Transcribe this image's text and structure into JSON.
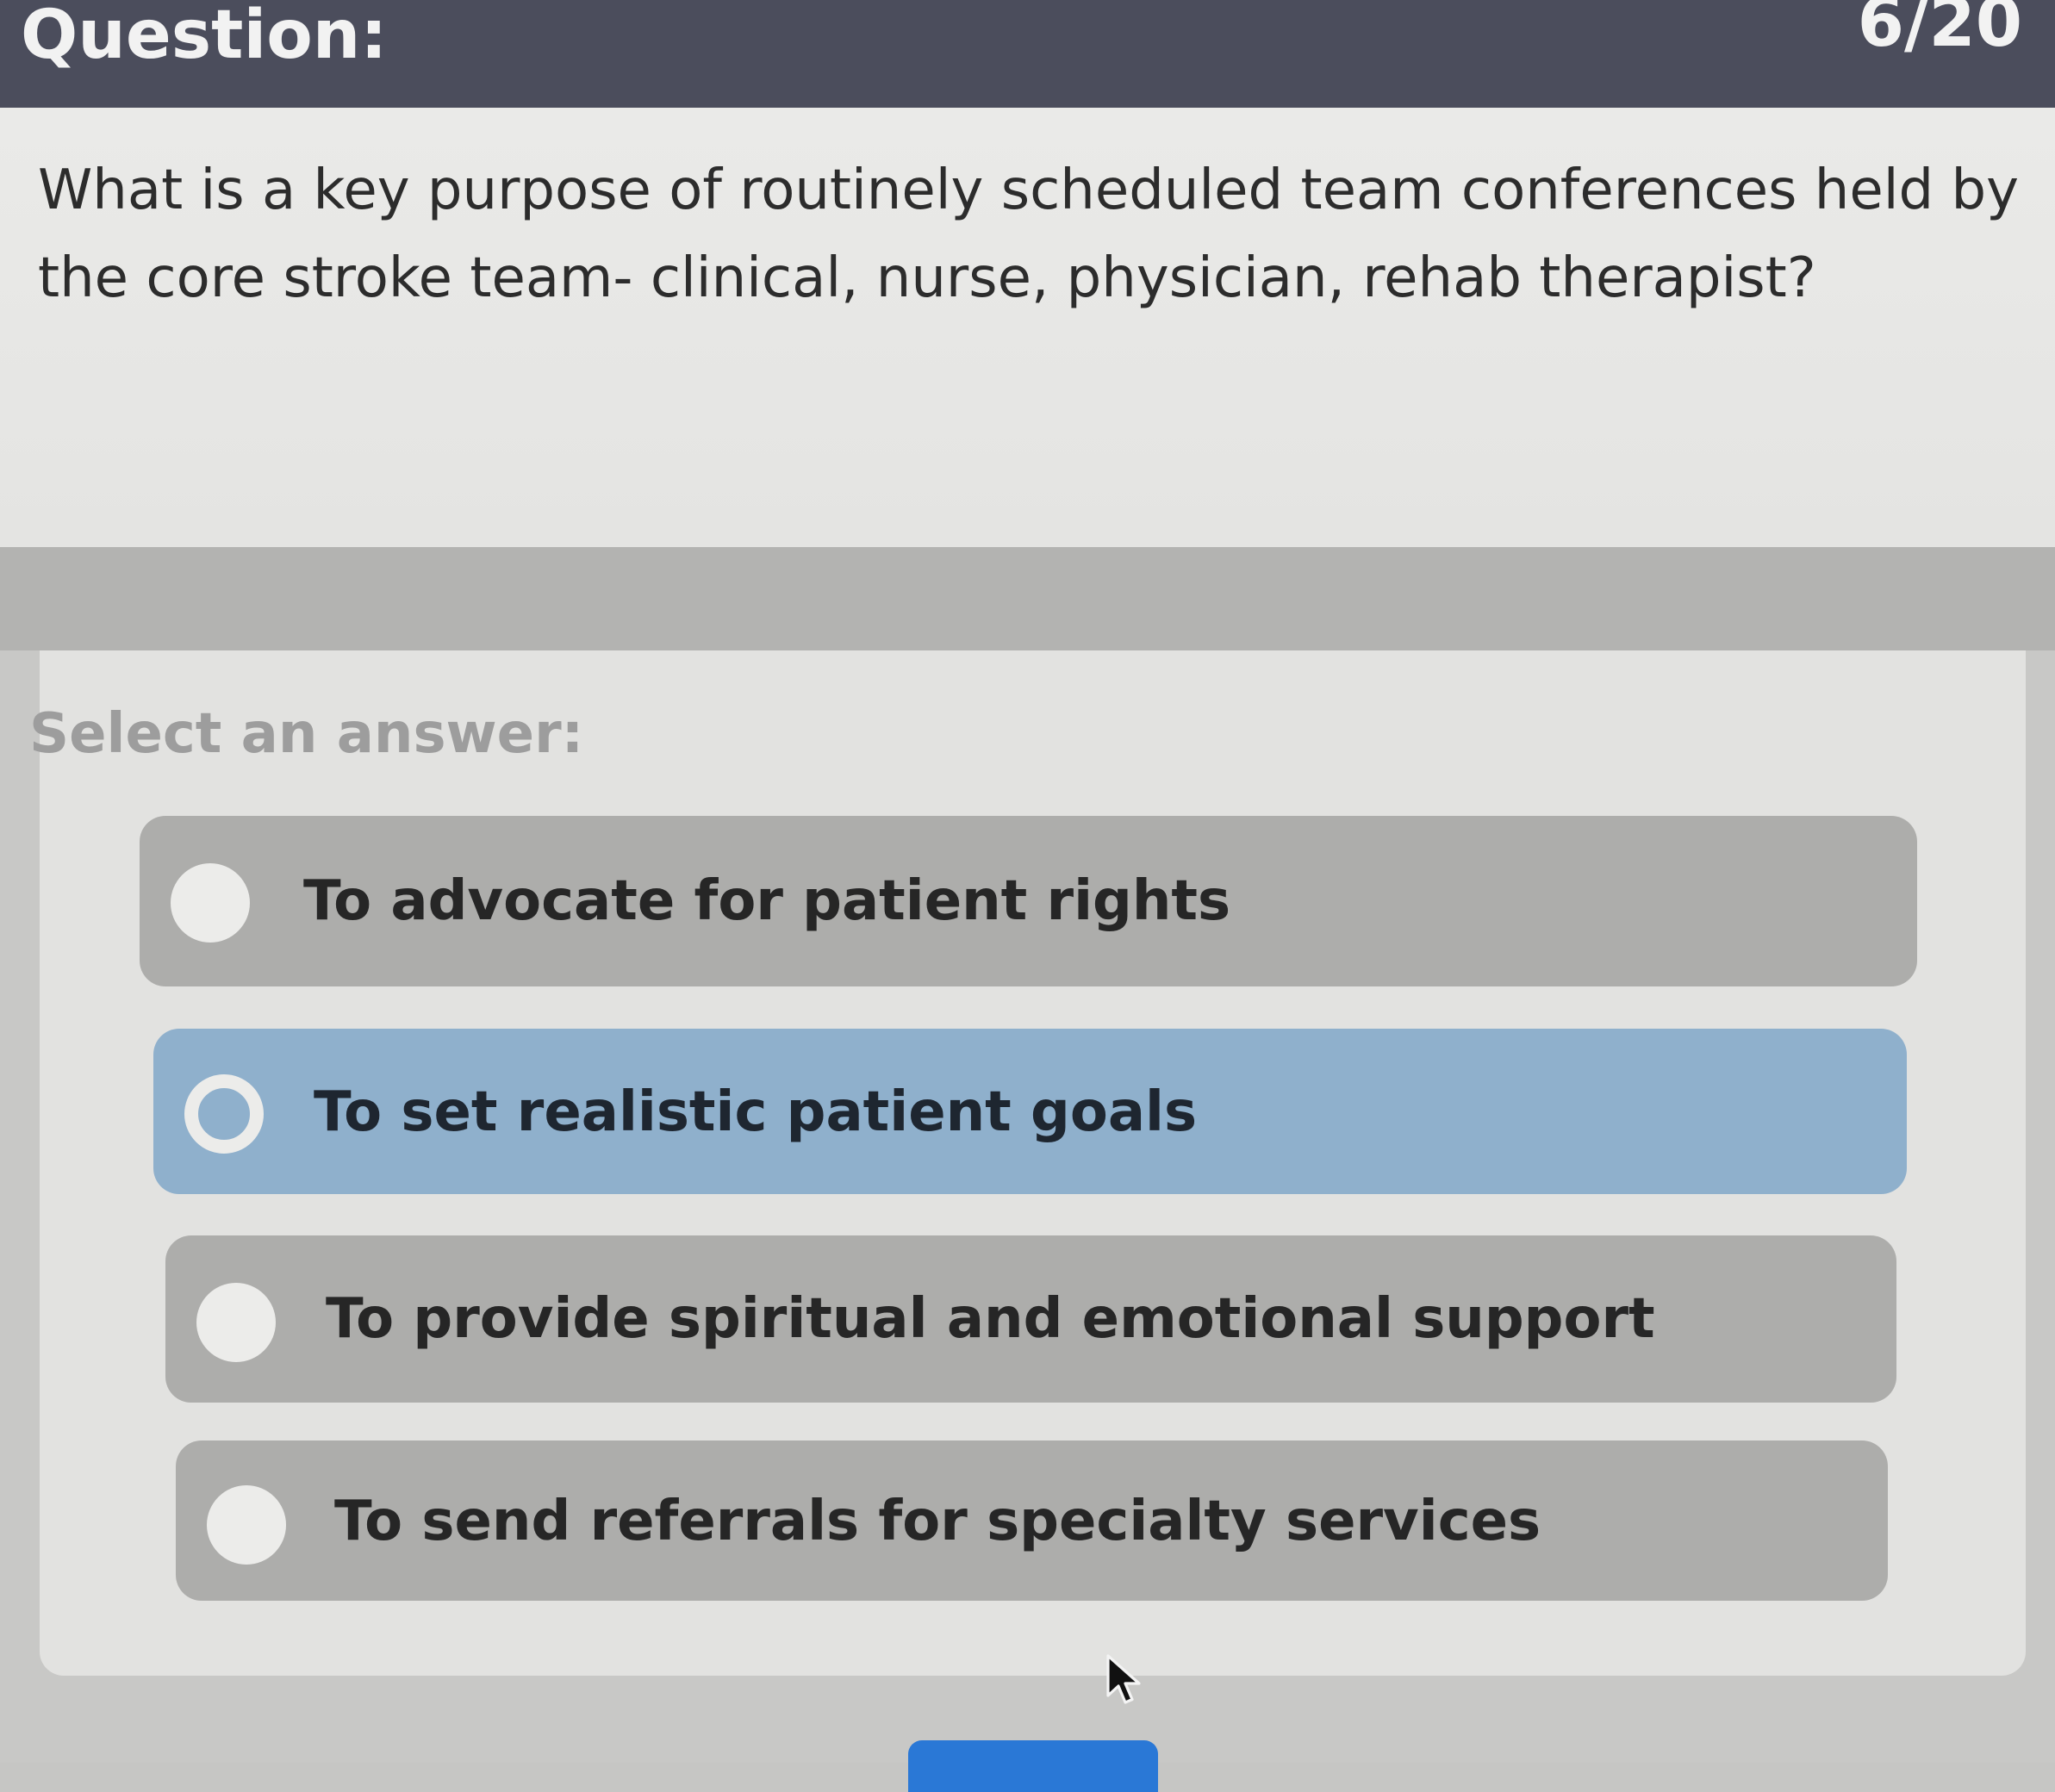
{
  "header": {
    "title": "Question:",
    "counter": "6/20"
  },
  "question": {
    "text": "What is a key purpose of routinely scheduled team conferences held by the core stroke team- clinical, nurse, physician, rehab therapist?"
  },
  "answers": {
    "prompt": "Select an answer:",
    "selected_index": 1,
    "options": [
      {
        "label": "To advocate for patient rights"
      },
      {
        "label": "To set realistic patient goals"
      },
      {
        "label": "To provide spiritual and emotional support"
      },
      {
        "label": "To send referrals for specialty services"
      }
    ]
  },
  "colors": {
    "header_bg": "#4b4d5c",
    "selected_option_bg": "#8fb0cc",
    "option_bg": "#adadab",
    "submit_button": "#2a78d6"
  },
  "icons": {
    "cursor": "mouse-pointer-icon",
    "radio": "radio-button-icon"
  }
}
